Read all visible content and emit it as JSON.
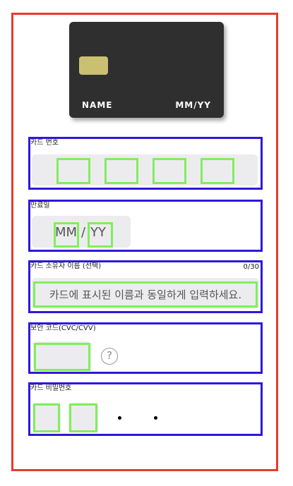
{
  "card_preview": {
    "name": "NAME",
    "expiry": "MM/YY"
  },
  "card_number": {
    "label": "카드 번호"
  },
  "expiration": {
    "label": "만료일",
    "month_placeholder": "MM",
    "separator": "/",
    "year_placeholder": "YY"
  },
  "owner_name": {
    "label": "카드 소유자 이름 (선택)",
    "counter": "0/30",
    "placeholder": "카드에 표시된 이름과 동일하게 입력하세요."
  },
  "security_code": {
    "label": "보안 코드(CVC/CVV)",
    "help_icon": "?"
  },
  "password": {
    "label": "카드 비밀번호",
    "masked_digits": 2
  },
  "colors": {
    "outer_frame": "#e63b2e",
    "section_border": "#2f18d9",
    "field_highlight": "#7ef05a",
    "card_background": "#2f2f30",
    "chip": "#cbbf72"
  }
}
